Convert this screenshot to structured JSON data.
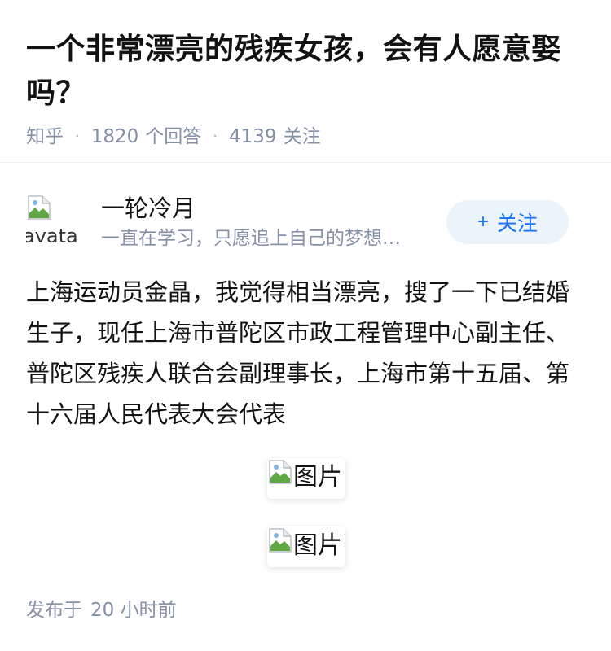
{
  "question": {
    "title": "一个非常漂亮的残疾女孩，会有人愿意娶吗？",
    "source": "知乎",
    "answer_count": "1820",
    "answer_label": "个回答",
    "follower_count": "4139",
    "follower_label": "关注",
    "separator": "·"
  },
  "author": {
    "avatar_alt": "avatar",
    "name": "一轮冷月",
    "bio": "一直在学习，只愿追上自己的梦想…",
    "follow_label": "关注",
    "follow_icon": "plus-icon"
  },
  "answer": {
    "text": "上海运动员金晶，我觉得相当漂亮，搜了一下已结婚生子，现任上海市普陀区市政工程管理中心副主任、普陀区残疾人联合会副理事长，上海市第十五届、第十六届人民代表大会代表",
    "images": [
      {
        "alt": "图片"
      },
      {
        "alt": "图片"
      }
    ],
    "publish_label": "发布于",
    "publish_time": "20 小时前"
  },
  "colors": {
    "accent": "#1772f6",
    "follow_bg": "#ebf3fb",
    "meta_gray": "#8590a6",
    "text": "#121212"
  }
}
